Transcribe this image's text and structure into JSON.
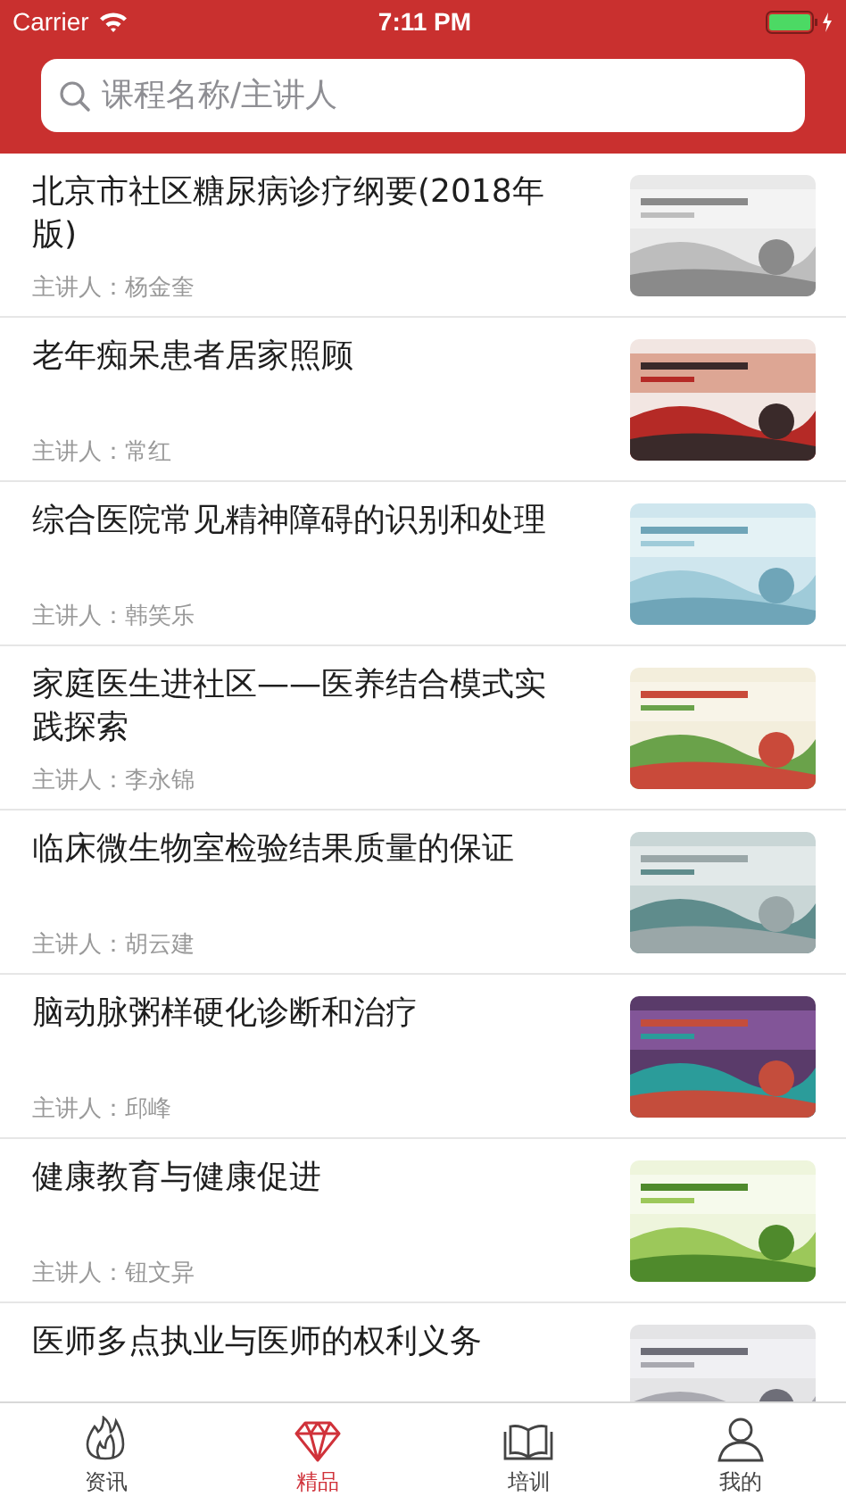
{
  "status_bar": {
    "carrier": "Carrier",
    "time": "7:11 PM"
  },
  "search": {
    "placeholder": "课程名称/主讲人"
  },
  "courses": [
    {
      "title": "北京市社区糖尿病诊疗纲要(2018年版)",
      "speaker": "主讲人：杨金奎"
    },
    {
      "title": "老年痴呆患者居家照顾",
      "speaker": "主讲人：常红"
    },
    {
      "title": "综合医院常见精神障碍的识别和处理",
      "speaker": "主讲人：韩笑乐"
    },
    {
      "title": "家庭医生进社区——医养结合模式实践探索",
      "speaker": "主讲人：李永锦"
    },
    {
      "title": "临床微生物室检验结果质量的保证",
      "speaker": "主讲人：胡云建"
    },
    {
      "title": "脑动脉粥样硬化诊断和治疗",
      "speaker": "主讲人：邱峰"
    },
    {
      "title": "健康教育与健康促进",
      "speaker": "主讲人：钮文异"
    },
    {
      "title": "医师多点执业与医师的权利义务"
    }
  ],
  "tabs": [
    {
      "label": "资讯",
      "selected": false
    },
    {
      "label": "精品",
      "selected": true
    },
    {
      "label": "培训",
      "selected": false
    },
    {
      "label": "我的",
      "selected": false
    }
  ]
}
